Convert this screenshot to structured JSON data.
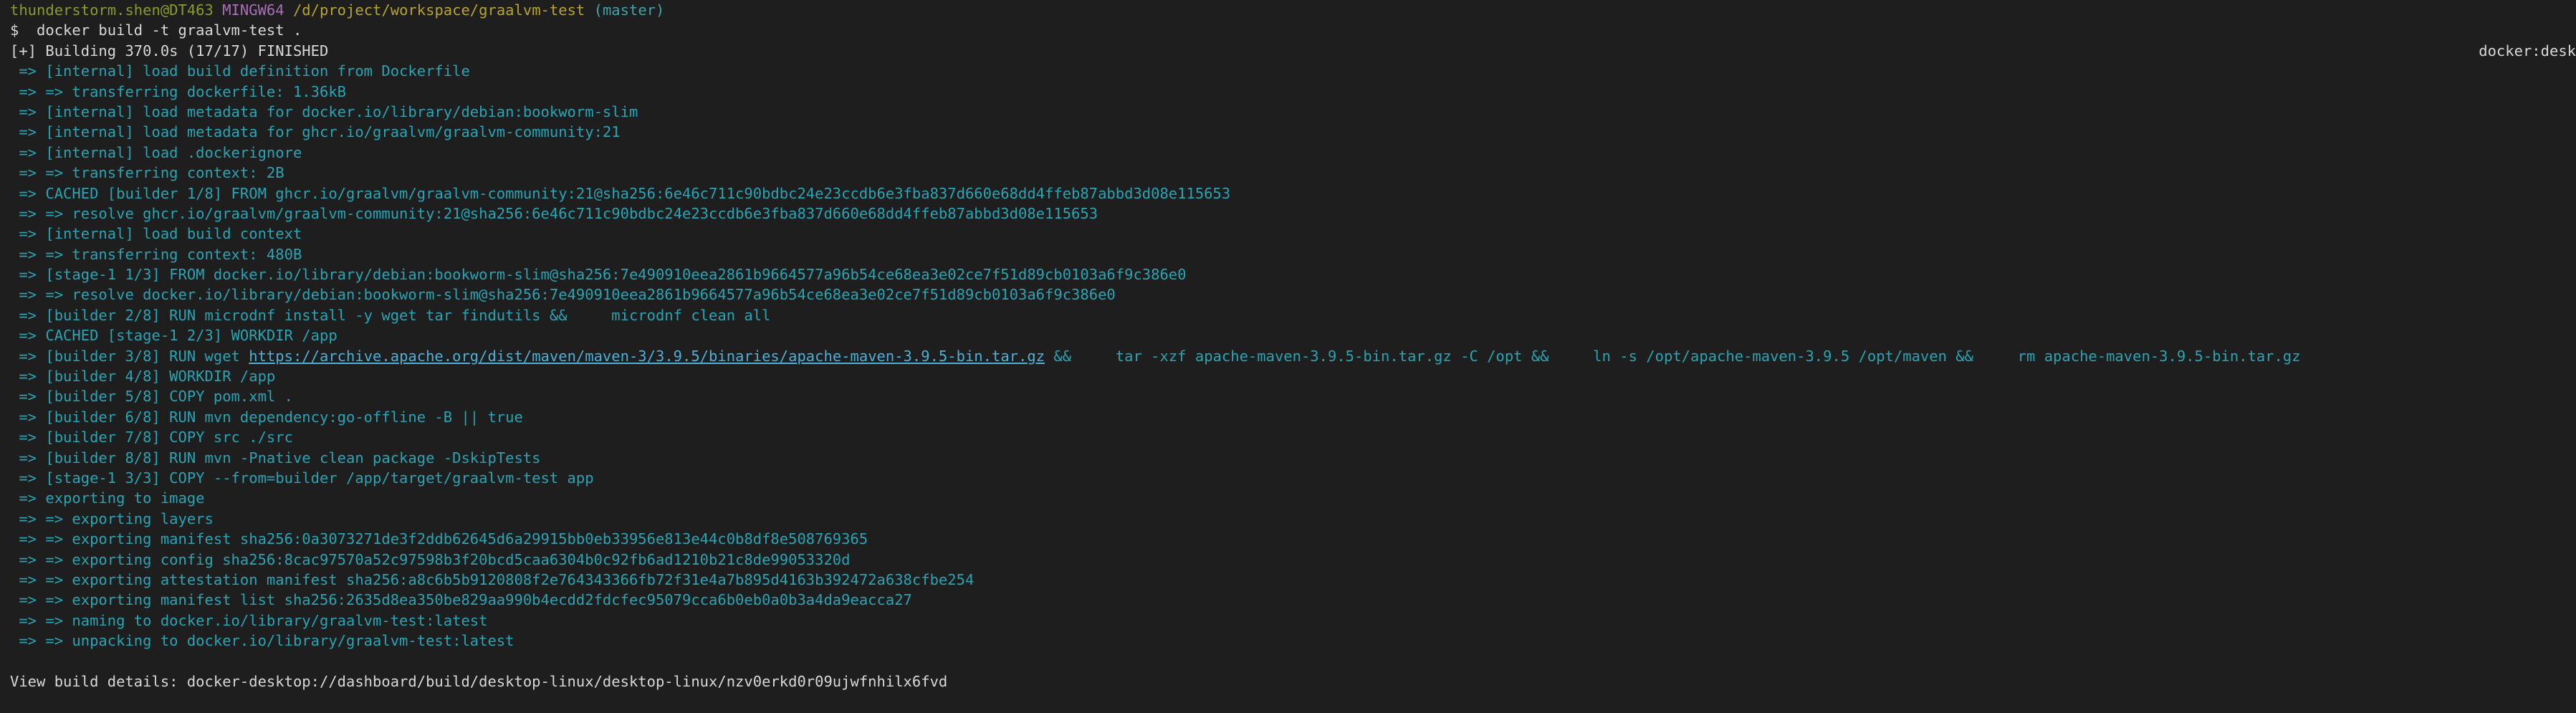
{
  "prompt": {
    "user_host": "thunderstorm.shen@DT463",
    "shell": "MINGW64",
    "path": "/d/project/workspace/graalvm-test",
    "branch": "(master)",
    "command": "$  docker build -t graalvm-test ."
  },
  "status": {
    "building": "[+] Building 370.0s (17/17) FINISHED",
    "driver_label": "docker:desk"
  },
  "build_steps": [
    {
      "text": " => [internal] load build definition from Dockerfile"
    },
    {
      "text": " => => transferring dockerfile: 1.36kB"
    },
    {
      "text": " => [internal] load metadata for docker.io/library/debian:bookworm-slim"
    },
    {
      "text": " => [internal] load metadata for ghcr.io/graalvm/graalvm-community:21"
    },
    {
      "text": " => [internal] load .dockerignore"
    },
    {
      "text": " => => transferring context: 2B"
    },
    {
      "text": " => CACHED [builder 1/8] FROM ghcr.io/graalvm/graalvm-community:21@sha256:6e46c711c90bdbc24e23ccdb6e3fba837d660e68dd4ffeb87abbd3d08e115653"
    },
    {
      "text": " => => resolve ghcr.io/graalvm/graalvm-community:21@sha256:6e46c711c90bdbc24e23ccdb6e3fba837d660e68dd4ffeb87abbd3d08e115653"
    },
    {
      "text": " => [internal] load build context"
    },
    {
      "text": " => => transferring context: 480B"
    },
    {
      "text": " => [stage-1 1/3] FROM docker.io/library/debian:bookworm-slim@sha256:7e490910eea2861b9664577a96b54ce68ea3e02ce7f51d89cb0103a6f9c386e0"
    },
    {
      "text": " => => resolve docker.io/library/debian:bookworm-slim@sha256:7e490910eea2861b9664577a96b54ce68ea3e02ce7f51d89cb0103a6f9c386e0"
    },
    {
      "text": " => [builder 2/8] RUN microdnf install -y wget tar findutils &&     microdnf clean all"
    },
    {
      "text": " => CACHED [stage-1 2/3] WORKDIR /app"
    }
  ],
  "wget_step": {
    "prefix": " => [builder 3/8] RUN wget ",
    "url": "https://archive.apache.org/dist/maven/maven-3/3.9.5/binaries/apache-maven-3.9.5-bin.tar.gz",
    "suffix": " &&     tar -xzf apache-maven-3.9.5-bin.tar.gz -C /opt &&     ln -s /opt/apache-maven-3.9.5 /opt/maven &&     rm apache-maven-3.9.5-bin.tar.gz"
  },
  "build_steps_2": [
    {
      "text": " => [builder 4/8] WORKDIR /app"
    },
    {
      "text": " => [builder 5/8] COPY pom.xml ."
    },
    {
      "text": " => [builder 6/8] RUN mvn dependency:go-offline -B || true"
    },
    {
      "text": " => [builder 7/8] COPY src ./src"
    },
    {
      "text": " => [builder 8/8] RUN mvn -Pnative clean package -DskipTests"
    },
    {
      "text": " => [stage-1 3/3] COPY --from=builder /app/target/graalvm-test app"
    },
    {
      "text": " => exporting to image"
    },
    {
      "text": " => => exporting layers"
    },
    {
      "text": " => => exporting manifest sha256:0a3073271de3f2ddb62645d6a29915bb0eb33956e813e44c0b8df8e508769365"
    },
    {
      "text": " => => exporting config sha256:8cac97570a52c97598b3f20bcd5caa6304b0c92fb6ad1210b21c8de99053320d"
    },
    {
      "text": " => => exporting attestation manifest sha256:a8c6b5b9120808f2e764343366fb72f31e4a7b895d4163b392472a638cfbe254"
    },
    {
      "text": " => => exporting manifest list sha256:2635d8ea350be829aa990b4ecdd2fdcfec95079cca6b0eb0a0b3a4da9eacca27"
    },
    {
      "text": " => => naming to docker.io/library/graalvm-test:latest"
    },
    {
      "text": " => => unpacking to docker.io/library/graalvm-test:latest"
    }
  ],
  "footer": {
    "details": "View build details: docker-desktop://dashboard/build/desktop-linux/desktop-linux/nzv0erkd0r09ujwfnhilx6fvd"
  },
  "colors": {
    "background": "#1e1e1e",
    "step_text": "#28a4b4",
    "prompt_user": "#8a9a2c",
    "prompt_shell": "#a96fb8",
    "prompt_path": "#b7a42f",
    "prompt_branch": "#3fa3a8"
  }
}
